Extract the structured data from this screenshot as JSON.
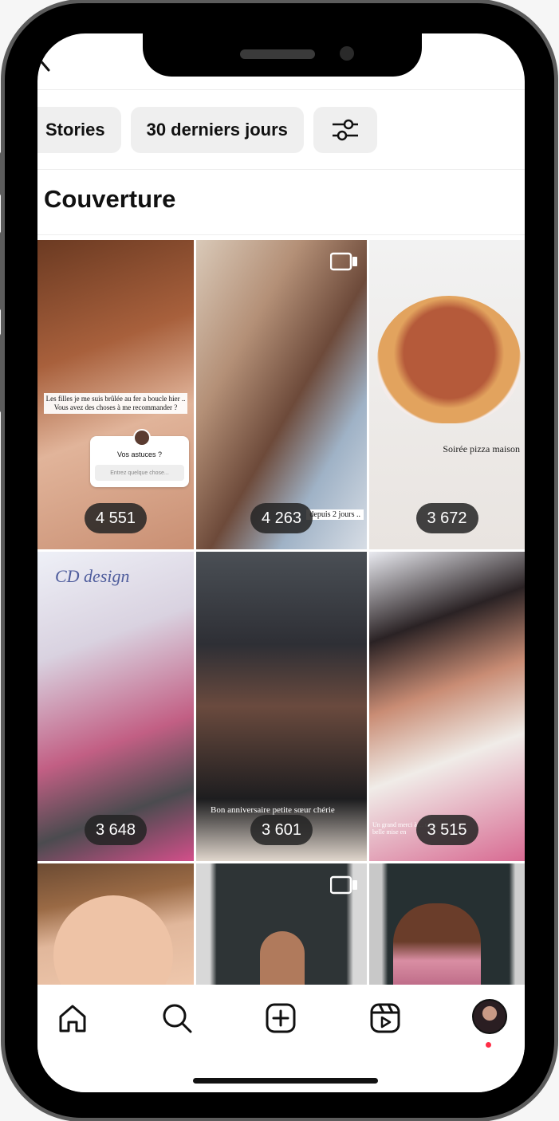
{
  "filters": {
    "chip_type": "Stories",
    "chip_period": "30 derniers jours",
    "chip_settings_icon": "sliders-icon"
  },
  "section": {
    "title": "Couverture"
  },
  "grid": {
    "items": [
      {
        "count": "4 551",
        "caption": "Les filles je me suis brûlée au fer a boucle hier .. Vous avez des choses à me recommander ?",
        "question": "Vos astuces ?",
        "placeholder": "Entrez quelque chose..."
      },
      {
        "count": "4 263",
        "caption": "depuis 2 jours ..",
        "reel_icon": "video-icon"
      },
      {
        "count": "3 672",
        "caption": "Soirée pizza maison"
      },
      {
        "count": "3 648",
        "caption": "CD design"
      },
      {
        "count": "3 601",
        "caption": "Bon anniversaire petite sœur chérie"
      },
      {
        "count": "3 515",
        "caption": "Un grand merci à ... cette belle mise en"
      },
      {
        "count": "",
        "caption": ""
      },
      {
        "count": "",
        "caption": "",
        "reel_icon": "video-icon"
      },
      {
        "count": "",
        "caption": ""
      }
    ]
  },
  "nav": {
    "home_icon": "home-icon",
    "search_icon": "search-icon",
    "create_icon": "plus-square-icon",
    "reels_icon": "reels-icon",
    "profile_icon": "avatar"
  },
  "colors": {
    "chip_bg": "#efefef",
    "badge_bg": "#232323",
    "notification": "#ff2d46"
  }
}
